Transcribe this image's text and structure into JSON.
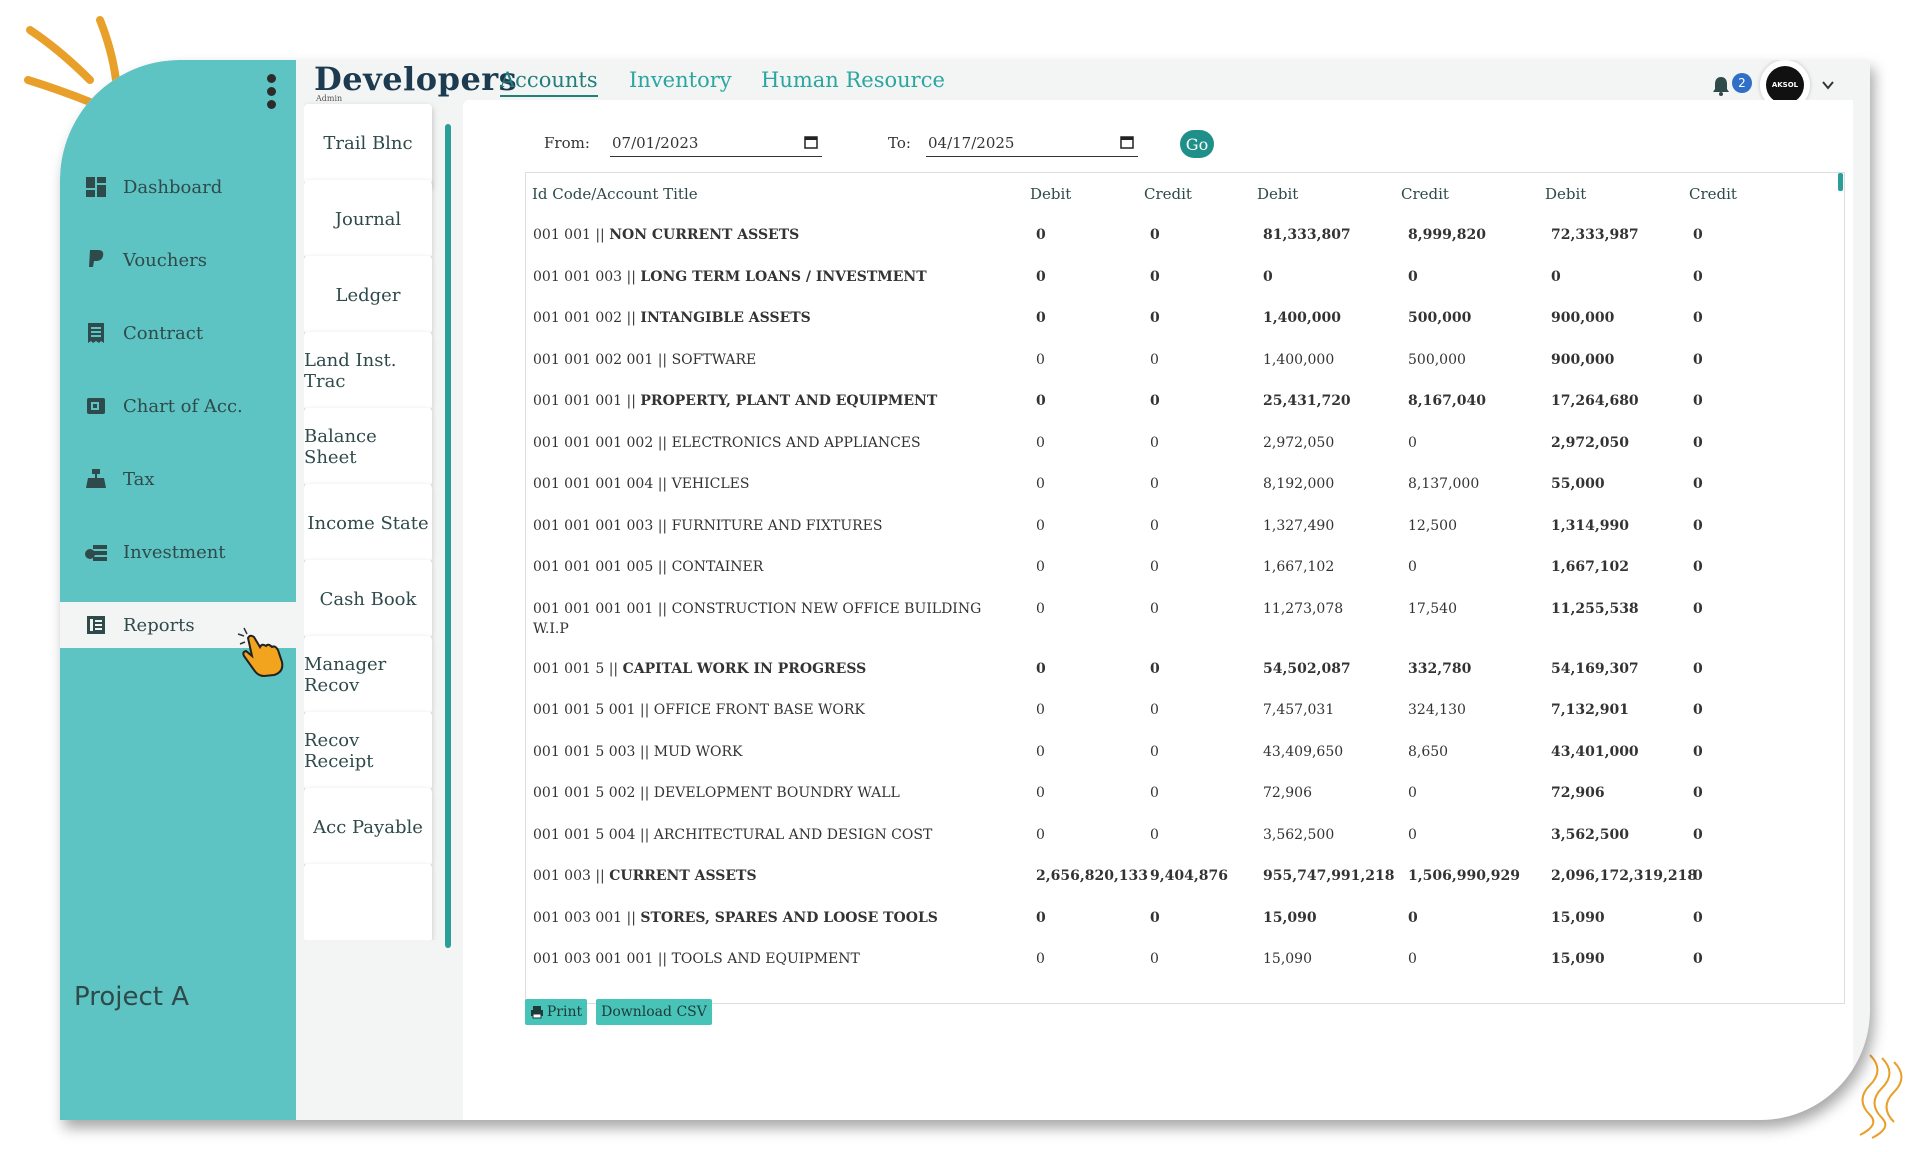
{
  "brand": {
    "title": "Developers",
    "subtitle": "Admin"
  },
  "tabs": [
    {
      "label": "Accounts",
      "active": true
    },
    {
      "label": "Inventory",
      "active": false
    },
    {
      "label": "Human Resource",
      "active": false
    }
  ],
  "notifications": {
    "count": "2"
  },
  "avatar": {
    "text": "AKSOL"
  },
  "sidebar": {
    "items": [
      {
        "label": "Dashboard",
        "icon": "dashboard-icon"
      },
      {
        "label": "Vouchers",
        "icon": "paypal-icon"
      },
      {
        "label": "Contract",
        "icon": "receipt-icon"
      },
      {
        "label": "Chart of Acc.",
        "icon": "chart-book-icon"
      },
      {
        "label": "Tax",
        "icon": "cash-register-icon"
      },
      {
        "label": "Investment",
        "icon": "money-stack-icon"
      },
      {
        "label": "Reports",
        "icon": "report-icon",
        "active": true
      }
    ],
    "project": "Project A"
  },
  "reports": [
    "Trail Blnc",
    "Journal",
    "Ledger",
    "Land Inst. Trac",
    "Balance Sheet",
    "Income State",
    "Cash Book",
    "Manager Recov",
    "Recov Receipt",
    "Acc Payable"
  ],
  "filter": {
    "from_label": "From:",
    "from_value": "07/01/2023",
    "to_label": "To:",
    "to_value": "04/17/2025",
    "go_label": "Go"
  },
  "table": {
    "headers": [
      "Id Code/Account Title",
      "Debit",
      "Credit",
      "Debit",
      "Credit",
      "Debit",
      "Credit"
    ],
    "rows": [
      {
        "code": "001 001 ||",
        "title": "NON CURRENT ASSETS",
        "bold": true,
        "c": [
          "0",
          "0",
          "81,333,807",
          "8,999,820",
          "72,333,987",
          "0"
        ]
      },
      {
        "code": "001 001 003 ||",
        "title": "LONG TERM LOANS / INVESTMENT",
        "bold": true,
        "c": [
          "0",
          "0",
          "0",
          "0",
          "0",
          "0"
        ]
      },
      {
        "code": "001 001 002 ||",
        "title": "INTANGIBLE ASSETS",
        "bold": true,
        "c": [
          "0",
          "0",
          "1,400,000",
          "500,000",
          "900,000",
          "0"
        ]
      },
      {
        "code": "001 001 002 001 ||",
        "title": "SOFTWARE",
        "bold": false,
        "c": [
          "0",
          "0",
          "1,400,000",
          "500,000",
          "900,000",
          "0"
        ]
      },
      {
        "code": "001 001 001 ||",
        "title": "PROPERTY, PLANT AND EQUIPMENT",
        "bold": true,
        "c": [
          "0",
          "0",
          "25,431,720",
          "8,167,040",
          "17,264,680",
          "0"
        ]
      },
      {
        "code": "001 001 001 002 ||",
        "title": "ELECTRONICS AND APPLIANCES",
        "bold": false,
        "c": [
          "0",
          "0",
          "2,972,050",
          "0",
          "2,972,050",
          "0"
        ]
      },
      {
        "code": "001 001 001 004 ||",
        "title": "VEHICLES",
        "bold": false,
        "c": [
          "0",
          "0",
          "8,192,000",
          "8,137,000",
          "55,000",
          "0"
        ]
      },
      {
        "code": "001 001 001 003 ||",
        "title": "FURNITURE AND FIXTURES",
        "bold": false,
        "c": [
          "0",
          "0",
          "1,327,490",
          "12,500",
          "1,314,990",
          "0"
        ]
      },
      {
        "code": "001 001 001 005 ||",
        "title": "CONTAINER",
        "bold": false,
        "c": [
          "0",
          "0",
          "1,667,102",
          "0",
          "1,667,102",
          "0"
        ]
      },
      {
        "code": "001 001 001 001 ||",
        "title": "CONSTRUCTION NEW OFFICE BUILDING W.I.P",
        "bold": false,
        "c": [
          "0",
          "0",
          "11,273,078",
          "17,540",
          "11,255,538",
          "0"
        ]
      },
      {
        "code": "001 001 5 ||",
        "title": "CAPITAL WORK IN PROGRESS",
        "bold": true,
        "c": [
          "0",
          "0",
          "54,502,087",
          "332,780",
          "54,169,307",
          "0"
        ]
      },
      {
        "code": "001 001 5 001 ||",
        "title": "OFFICE FRONT BASE WORK",
        "bold": false,
        "c": [
          "0",
          "0",
          "7,457,031",
          "324,130",
          "7,132,901",
          "0"
        ]
      },
      {
        "code": "001 001 5 003 ||",
        "title": "MUD WORK",
        "bold": false,
        "c": [
          "0",
          "0",
          "43,409,650",
          "8,650",
          "43,401,000",
          "0"
        ]
      },
      {
        "code": "001 001 5 002 ||",
        "title": "DEVELOPMENT BOUNDRY WALL",
        "bold": false,
        "c": [
          "0",
          "0",
          "72,906",
          "0",
          "72,906",
          "0"
        ]
      },
      {
        "code": "001 001 5 004 ||",
        "title": "ARCHITECTURAL AND DESIGN COST",
        "bold": false,
        "c": [
          "0",
          "0",
          "3,562,500",
          "0",
          "3,562,500",
          "0"
        ]
      },
      {
        "code": "001 003 ||",
        "title": "CURRENT ASSETS",
        "bold": true,
        "c": [
          "2,656,820,133",
          "9,404,876",
          "955,747,991,218",
          "1,506,990,929",
          "2,096,172,319,218",
          "0"
        ]
      },
      {
        "code": "001 003 001 ||",
        "title": "STORES, SPARES AND LOOSE TOOLS",
        "bold": true,
        "c": [
          "0",
          "0",
          "15,090",
          "0",
          "15,090",
          "0"
        ]
      },
      {
        "code": "001 003 001 001 ||",
        "title": "TOOLS AND EQUIPMENT",
        "bold": false,
        "c": [
          "0",
          "0",
          "15,090",
          "0",
          "15,090",
          "0"
        ]
      }
    ]
  },
  "actions": {
    "print_label": "Print",
    "csv_label": "Download CSV"
  },
  "colors": {
    "sidebar": "#5ec3c3",
    "accent": "#2a9e98",
    "brand": "#1d3b50",
    "button": "#47c3b7"
  }
}
